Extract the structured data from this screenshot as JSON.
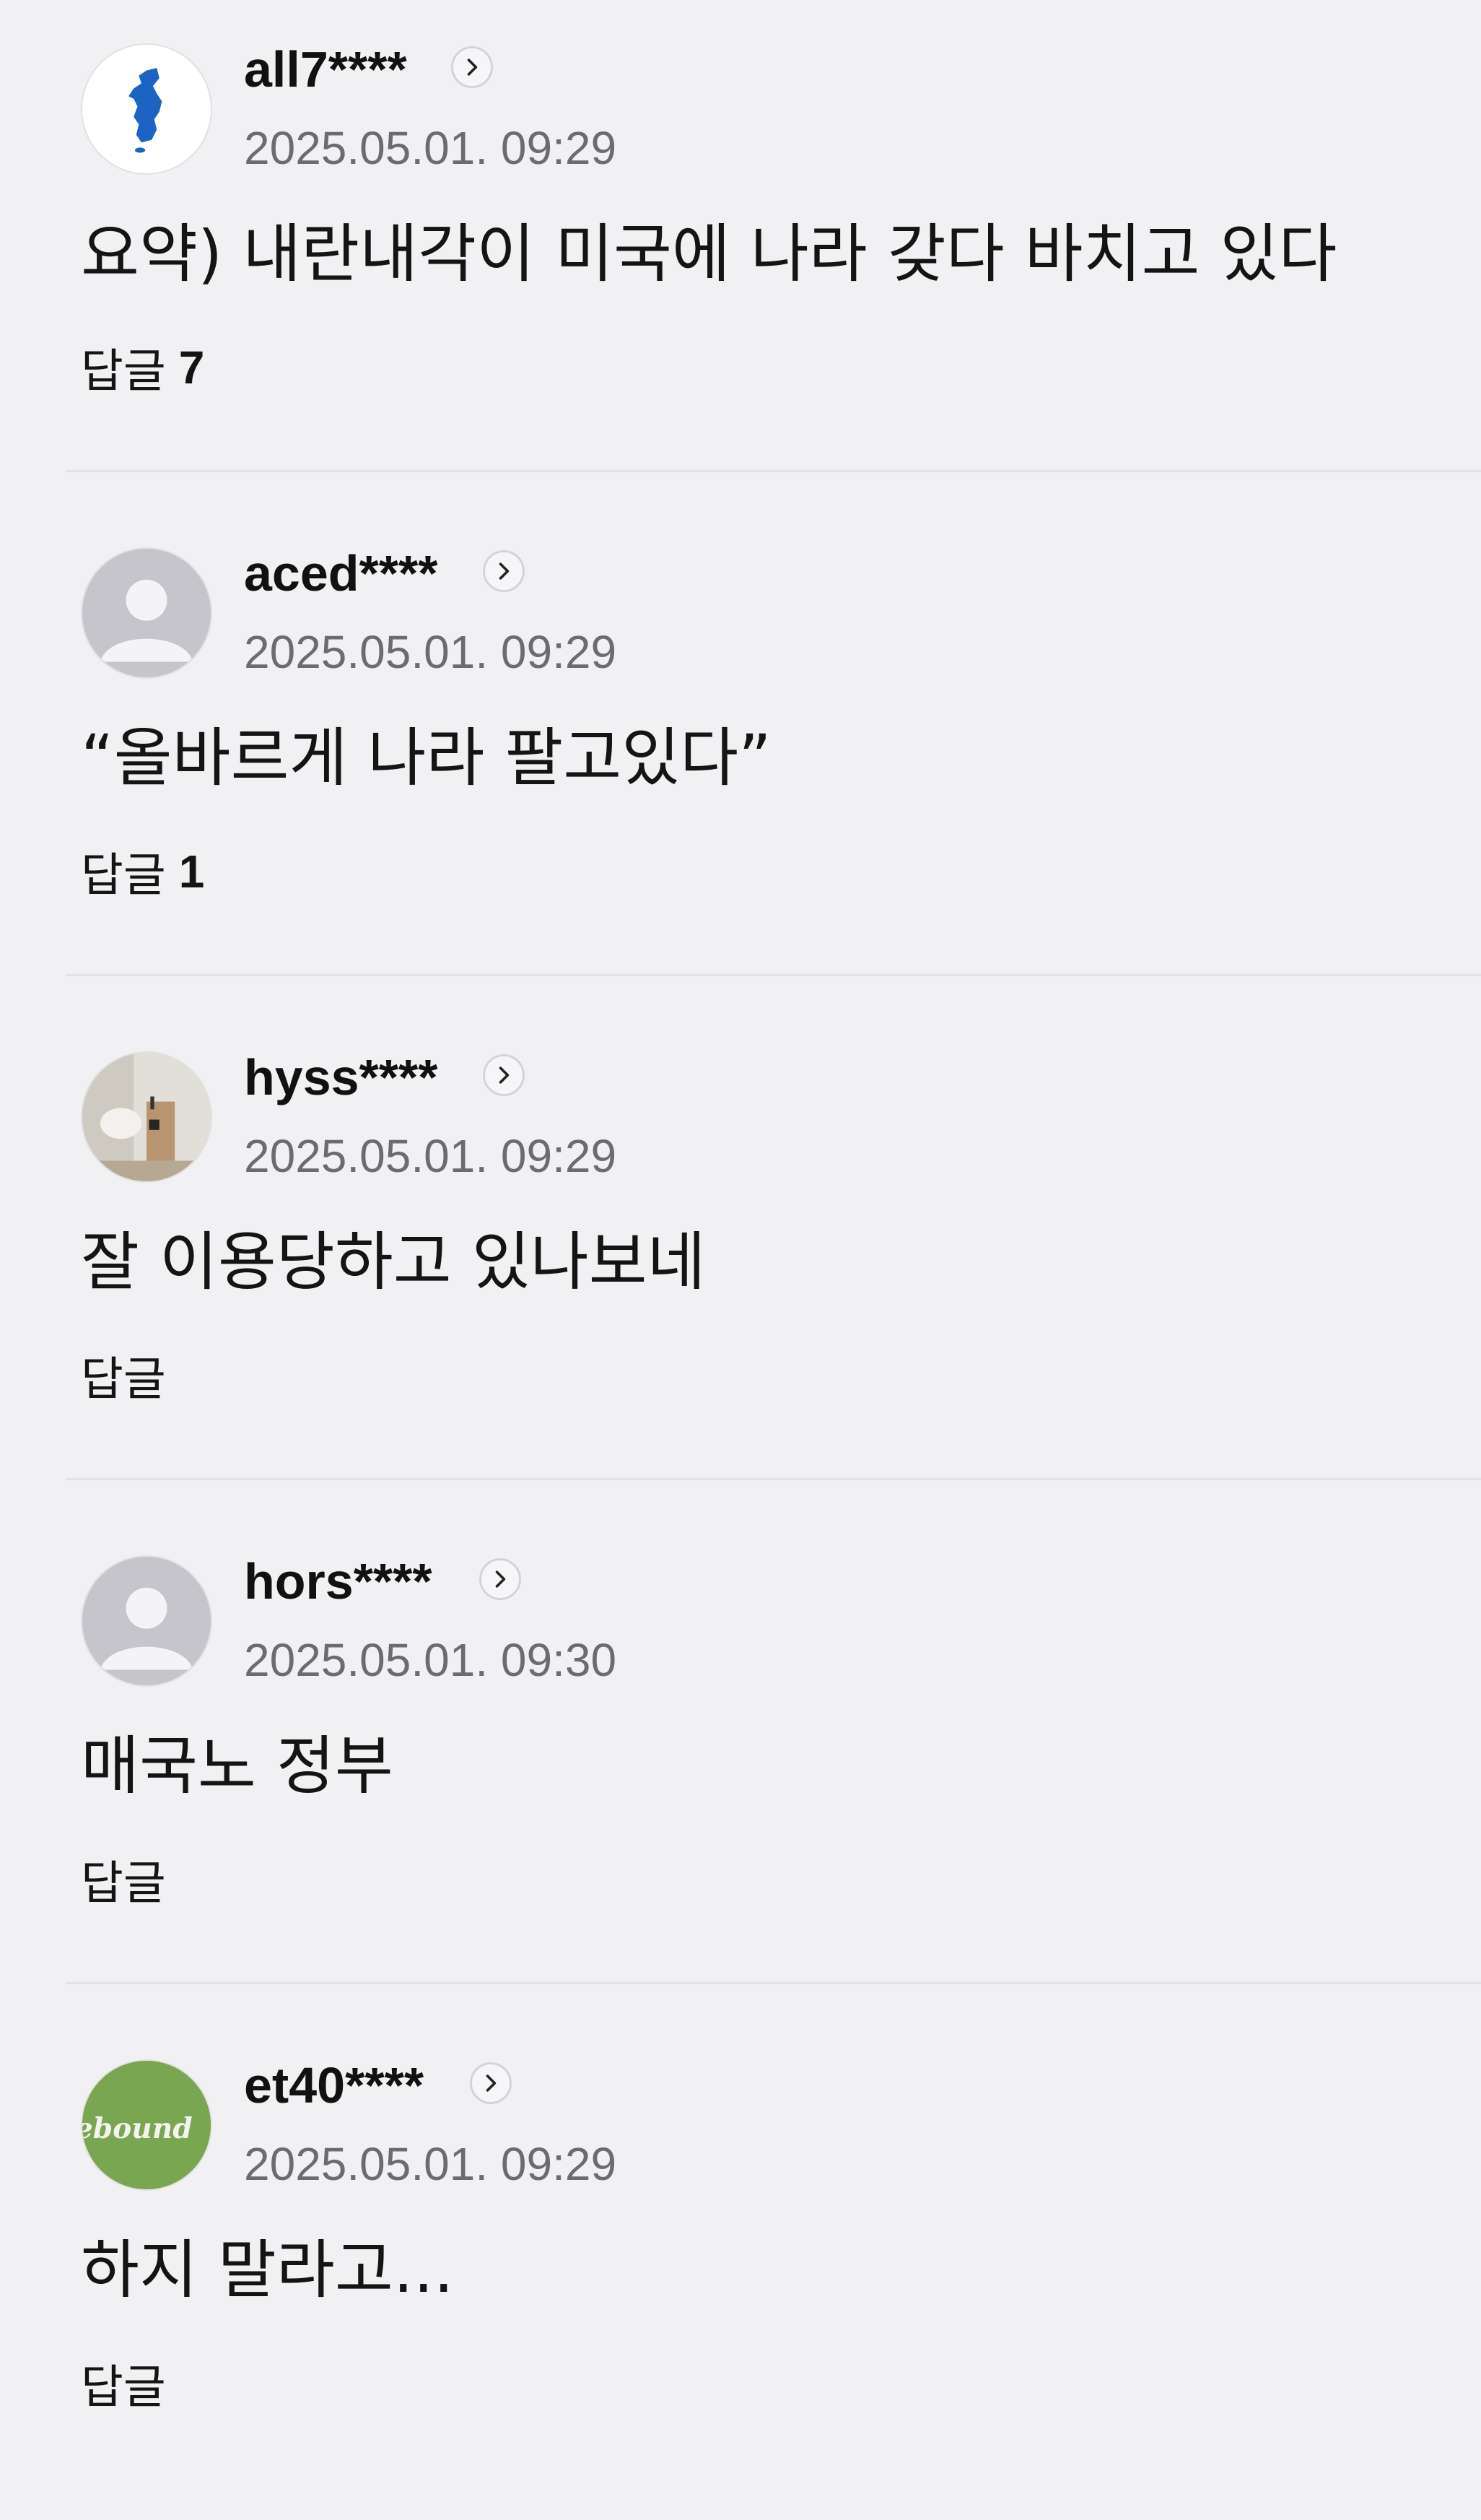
{
  "reply_label": "답글",
  "comments": [
    {
      "username": "all7****",
      "timestamp": "2025.05.01. 09:29",
      "text": "요약) 내란내각이 미국에 나라 갖다 바치고 있다",
      "reply_count": "7",
      "avatar_icon": "korea-map-avatar"
    },
    {
      "username": "aced****",
      "timestamp": "2025.05.01. 09:29",
      "text": "“올바르게 나라 팔고있다”",
      "reply_count": "1",
      "avatar_icon": "default-user-avatar"
    },
    {
      "username": "hyss****",
      "timestamp": "2025.05.01. 09:29",
      "text": "잘 이용당하고 있나보네",
      "reply_count": "",
      "avatar_icon": "photo-avatar"
    },
    {
      "username": "hors****",
      "timestamp": "2025.05.01. 09:30",
      "text": "매국노 정부",
      "reply_count": "",
      "avatar_icon": "default-user-avatar"
    },
    {
      "username": "et40****",
      "timestamp": "2025.05.01. 09:29",
      "text": "하지 말라고...",
      "reply_count": "",
      "avatar_icon": "green-logo-avatar",
      "avatar_logo_text": "ebound"
    }
  ],
  "colors": {
    "background": "#f1f1f3",
    "text": "#141414",
    "timestamp": "#6b6b70",
    "divider": "#e3e3e6",
    "avatar_green": "#7aa651",
    "korea_map_blue": "#1d63c4"
  }
}
